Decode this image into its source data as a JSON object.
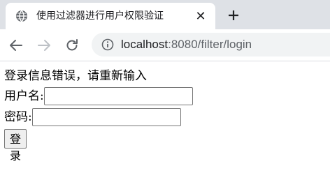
{
  "browser": {
    "tab": {
      "title": "使用过滤器进行用户权限验证",
      "close_glyph": "✕",
      "favicon": "globe-icon"
    },
    "new_tab_icon": "plus-icon",
    "nav": {
      "back_icon": "arrow-left-icon",
      "forward_icon": "arrow-right-icon",
      "reload_icon": "reload-icon"
    },
    "address": {
      "icon": "info-icon",
      "host": "localhost",
      "rest": ":8080/filter/login"
    },
    "colors": {
      "frame": "#dee1e6",
      "omnibox": "#f1f3f4",
      "text": "#202124",
      "muted": "#5f6368"
    }
  },
  "page": {
    "error_message": "登录信息错误，请重新输入",
    "username_label": "用户名:",
    "username_value": "",
    "password_label": "密码:",
    "password_value": "",
    "submit_label": "登录"
  }
}
